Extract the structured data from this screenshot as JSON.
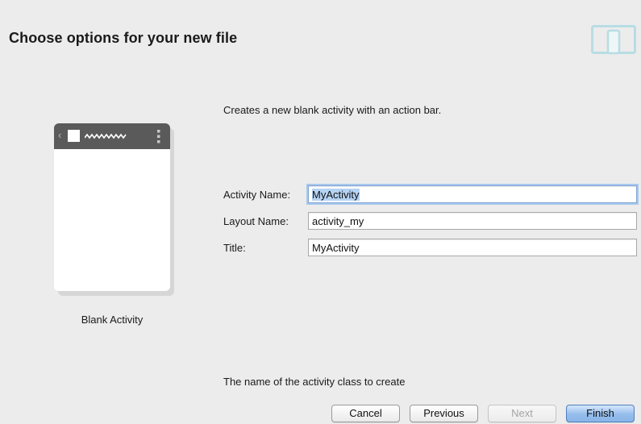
{
  "header": {
    "title": "Choose options for your new file",
    "icon": "device-phone-tablet-icon"
  },
  "preview": {
    "caption": "Blank Activity",
    "bar_color": "#5a5a5a"
  },
  "description": "Creates a new blank activity with an action bar.",
  "form": {
    "fields": [
      {
        "label": "Activity Name:",
        "value": "MyActivity",
        "focused": true,
        "text_selected": true
      },
      {
        "label": "Layout Name:",
        "value": "activity_my"
      },
      {
        "label": "Title:",
        "value": "MyActivity"
      }
    ]
  },
  "hint": "The name of the activity class to create",
  "buttons": {
    "cancel": "Cancel",
    "previous": "Previous",
    "next": "Next",
    "finish": "Finish"
  },
  "colors": {
    "focus_ring": "#a8c8ec",
    "selection": "#b5d3f3",
    "primary_button": "#95bdec"
  }
}
